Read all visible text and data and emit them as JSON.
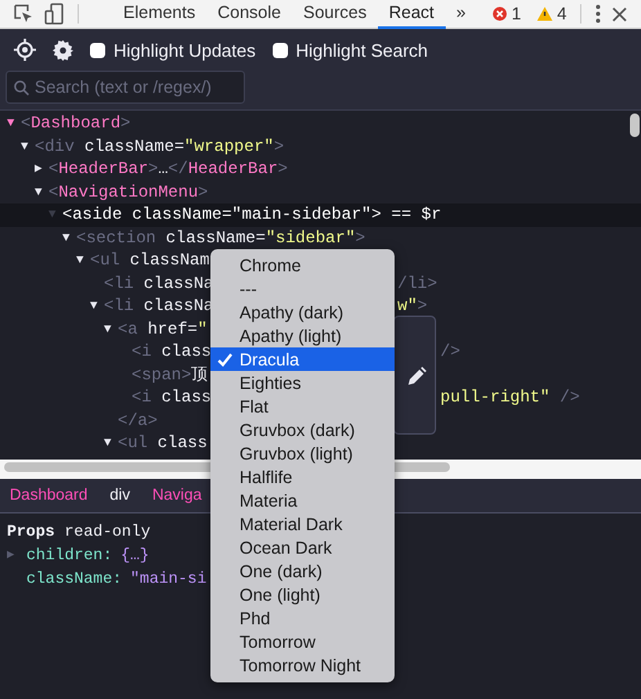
{
  "devtools_tabs": [
    {
      "label": "Elements",
      "selected": false
    },
    {
      "label": "Console",
      "selected": false
    },
    {
      "label": "Sources",
      "selected": false
    },
    {
      "label": "React",
      "selected": true
    },
    {
      "label": "»",
      "selected": false
    }
  ],
  "status": {
    "errors": "1",
    "warnings": "4"
  },
  "toolbar": {
    "options": [
      {
        "label": "Highlight Updates",
        "checked": false
      },
      {
        "label": "Highlight Search",
        "checked": false
      }
    ]
  },
  "search": {
    "placeholder": "Search (text or /regex/)"
  },
  "tree": [
    {
      "arrow": "▼",
      "selected": false,
      "tokens": [
        {
          "text": "<",
          "kind": "punct"
        },
        {
          "text": "Dashboard",
          "kind": "component"
        },
        {
          "text": ">",
          "kind": "punct"
        }
      ],
      "children": [
        {
          "arrow": "▼",
          "selected": false,
          "tokens": [
            {
              "text": "<div",
              "kind": "punct"
            },
            {
              "text": " className=",
              "kind": "attr"
            },
            {
              "text": "\"wrapper\"",
              "kind": "value"
            },
            {
              "text": ">",
              "kind": "punct"
            }
          ],
          "children": [
            {
              "arrow": "▶",
              "selected": false,
              "tokens": [
                {
                  "text": "<",
                  "kind": "punct"
                },
                {
                  "text": "HeaderBar",
                  "kind": "component"
                },
                {
                  "text": ">",
                  "kind": "punct"
                },
                {
                  "text": "…",
                  "kind": "attr"
                },
                {
                  "text": "</",
                  "kind": "punct"
                },
                {
                  "text": "HeaderBar",
                  "kind": "component"
                },
                {
                  "text": ">",
                  "kind": "punct"
                }
              ]
            },
            {
              "arrow": "▼",
              "selected": false,
              "tokens": [
                {
                  "text": "<",
                  "kind": "punct"
                },
                {
                  "text": "NavigationMenu",
                  "kind": "component"
                },
                {
                  "text": ">",
                  "kind": "punct"
                }
              ],
              "children": [
                {
                  "arrow": "▼",
                  "selected": true,
                  "tokens": [
                    {
                      "text": "<aside className=\"main-sidebar\"> == $r"
                    }
                  ],
                  "children": [
                    {
                      "arrow": "▼",
                      "selected": false,
                      "tokens": [
                        {
                          "text": "<section",
                          "kind": "punct"
                        },
                        {
                          "text": " className=",
                          "kind": "attr"
                        },
                        {
                          "text": "\"sidebar\"",
                          "kind": "value"
                        },
                        {
                          "text": ">",
                          "kind": "punct"
                        }
                      ],
                      "children": [
                        {
                          "arrow": "▼",
                          "selected": false,
                          "tokens": [
                            {
                              "text": "<ul",
                              "kind": "punct"
                            },
                            {
                              "text": " classNam",
                              "kind": "attr"
                            }
                          ],
                          "children": [
                            {
                              "selected": false,
                              "tokens": [
                                {
                                  "text": "<li",
                                  "kind": "punct"
                                },
                                {
                                  "text": " classNa",
                                  "kind": "attr"
                                }
                              ],
                              "tail": {
                                "kind": "menu",
                                "tokens": [
                                  {
                                    "text": "/li>",
                                    "kind": "punct"
                                  }
                                ]
                              }
                            },
                            {
                              "arrow": "▼",
                              "selected": false,
                              "tokens": [
                                {
                                  "text": "<li",
                                  "kind": "punct"
                                },
                                {
                                  "text": " classNa",
                                  "kind": "attr"
                                }
                              ],
                              "tail": {
                                "kind": "menu",
                                "tokens": [
                                  {
                                    "text": "w\"",
                                    "kind": "value"
                                  },
                                  {
                                    "text": ">",
                                    "kind": "punct"
                                  }
                                ]
                              },
                              "children": [
                                {
                                  "arrow": "▼",
                                  "selected": false,
                                  "tokens": [
                                    {
                                      "text": "<a",
                                      "kind": "punct"
                                    },
                                    {
                                      "text": " href=",
                                      "kind": "attr"
                                    },
                                    {
                                      "text": "\"",
                                      "kind": "value"
                                    }
                                  ],
                                  "closing": [
                                    {
                                      "text": "</a>",
                                      "kind": "punct"
                                    }
                                  ],
                                  "children": [
                                    {
                                      "selected": false,
                                      "tokens": [
                                        {
                                          "text": "<i",
                                          "kind": "punct"
                                        },
                                        {
                                          "text": " class",
                                          "kind": "attr"
                                        }
                                      ],
                                      "tail": {
                                        "kind": "popover",
                                        "tokens": [
                                          {
                                            "text": "/>",
                                            "kind": "punct"
                                          }
                                        ]
                                      }
                                    },
                                    {
                                      "selected": false,
                                      "tokens": [
                                        {
                                          "text": "<span>",
                                          "kind": "punct"
                                        },
                                        {
                                          "text": "顶",
                                          "kind": "attr"
                                        }
                                      ]
                                    },
                                    {
                                      "selected": false,
                                      "tokens": [
                                        {
                                          "text": "<i",
                                          "kind": "punct"
                                        },
                                        {
                                          "text": " class",
                                          "kind": "attr"
                                        }
                                      ],
                                      "tail": {
                                        "kind": "popover",
                                        "tokens": [
                                          {
                                            "text": "pull-right\"",
                                            "kind": "value"
                                          },
                                          {
                                            "text": " />",
                                            "kind": "punct"
                                          }
                                        ]
                                      }
                                    }
                                  ]
                                },
                                {
                                  "arrow": "▼",
                                  "selected": false,
                                  "tokens": [
                                    {
                                      "text": "<ul",
                                      "kind": "punct"
                                    },
                                    {
                                      "text": " class",
                                      "kind": "attr"
                                    }
                                  ]
                                }
                              ]
                            }
                          ]
                        }
                      ]
                    }
                  ]
                }
              ]
            }
          ]
        }
      ]
    }
  ],
  "breadcrumbs": [
    {
      "label": "Dashboard",
      "kind": "component"
    },
    {
      "label": "div",
      "kind": "host"
    },
    {
      "label": "Naviga",
      "kind": "component"
    }
  ],
  "props": {
    "title": "Props",
    "note": "read-only",
    "rows": [
      {
        "arrow": "▶",
        "key": "children:",
        "value": "{…}"
      },
      {
        "key": "className:",
        "value": "\"main-si"
      }
    ]
  },
  "theme_menu": [
    {
      "label": "Chrome",
      "selected": false
    },
    {
      "label": "---",
      "selected": false
    },
    {
      "label": "Apathy (dark)",
      "selected": false
    },
    {
      "label": "Apathy (light)",
      "selected": false
    },
    {
      "label": "Dracula",
      "selected": true
    },
    {
      "label": "Eighties",
      "selected": false
    },
    {
      "label": "Flat",
      "selected": false
    },
    {
      "label": "Gruvbox (dark)",
      "selected": false
    },
    {
      "label": "Gruvbox (light)",
      "selected": false
    },
    {
      "label": "Halflife",
      "selected": false
    },
    {
      "label": "Materia",
      "selected": false
    },
    {
      "label": "Material Dark",
      "selected": false
    },
    {
      "label": "Ocean Dark",
      "selected": false
    },
    {
      "label": "One (dark)",
      "selected": false
    },
    {
      "label": "One (light)",
      "selected": false
    },
    {
      "label": "Phd",
      "selected": false
    },
    {
      "label": "Tomorrow",
      "selected": false
    },
    {
      "label": "Tomorrow Night",
      "selected": false
    }
  ]
}
